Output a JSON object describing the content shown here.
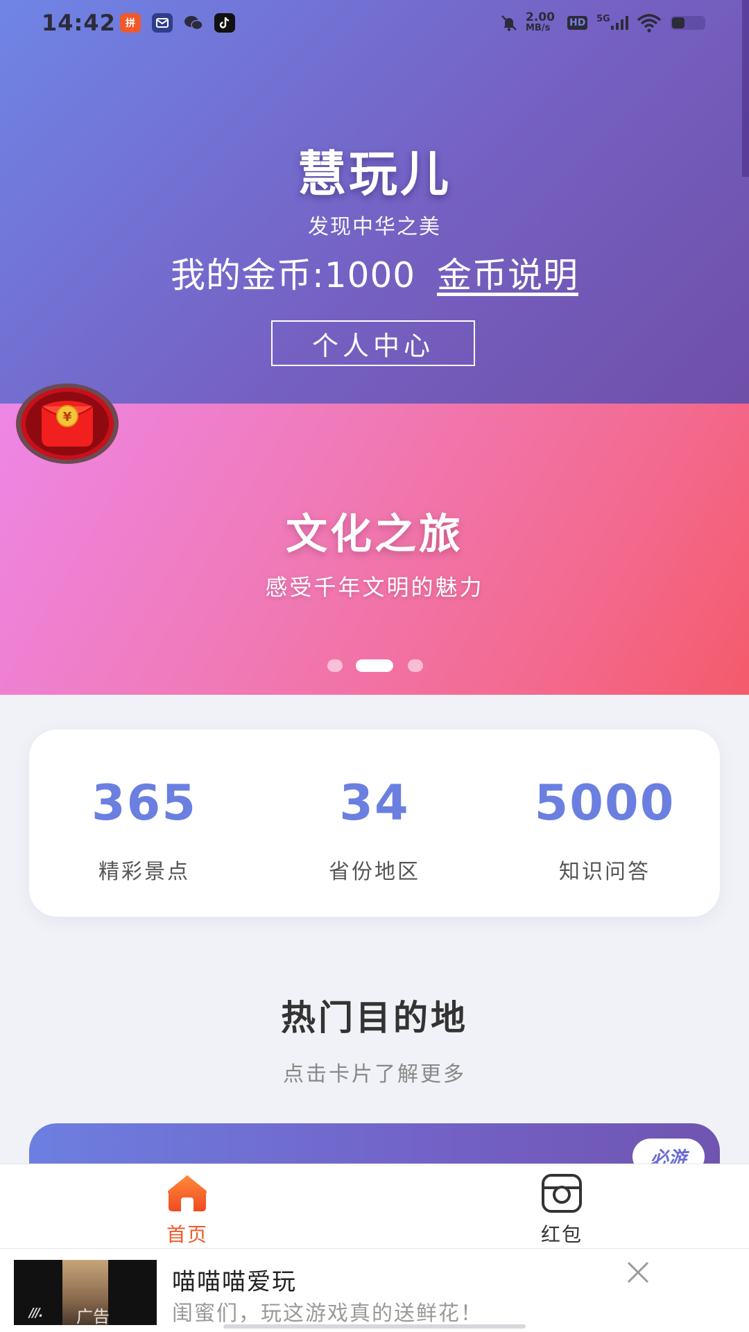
{
  "status_bar": {
    "time": "14:42",
    "net_speed_top": "2.00",
    "net_speed_bottom": "MB/s",
    "hd_label": "HD",
    "signal_label": "5G",
    "app_icons": [
      "pinduoduo-icon",
      "mail-icon",
      "wechat-icon",
      "tiktok-icon"
    ],
    "status_icons": [
      "mute-icon",
      "hd-icon",
      "5g-signal-icon",
      "wifi-icon",
      "battery-icon"
    ]
  },
  "header": {
    "title": "慧玩儿",
    "subtitle": "发现中华之美",
    "coins_label": "我的金币:1000",
    "coins_link": "金币说明",
    "center_button": "个人中心"
  },
  "float_button": {
    "icon": "red-packet-icon",
    "symbol": "¥"
  },
  "banner": {
    "title": "文化之旅",
    "subtitle": "感受千年文明的魅力",
    "slides": 3,
    "active_slide": 2
  },
  "stats": [
    {
      "value": "365",
      "label": "精彩景点"
    },
    {
      "value": "34",
      "label": "省份地区"
    },
    {
      "value": "5000",
      "label": "知识问答"
    }
  ],
  "destinations": {
    "title": "热门目的地",
    "subtitle": "点击卡片了解更多",
    "first_card_tag": "必游"
  },
  "bottom_nav": [
    {
      "label": "首页",
      "icon": "home-icon",
      "active": true
    },
    {
      "label": "红包",
      "icon": "red-packet-camera-icon",
      "active": false
    }
  ],
  "ad": {
    "badge": "广告",
    "title": "喵喵喵爱玩",
    "text": "闺蜜们，玩这游戏真的送鲜花！"
  },
  "colors": {
    "hero_gradient": [
      "#6f85e6",
      "#6f4fa8"
    ],
    "banner_gradient": [
      "#ee86e6",
      "#f45b6b"
    ],
    "stat_number": "#6a7fe0",
    "nav_active": "#f05a2a",
    "nav_inactive": "#333333"
  }
}
